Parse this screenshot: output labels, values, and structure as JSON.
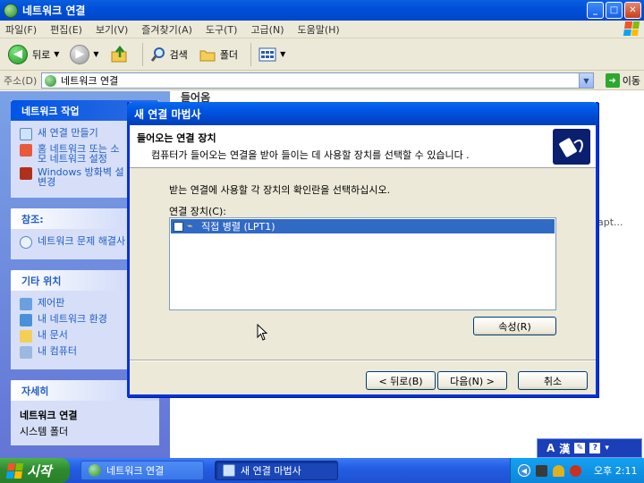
{
  "explorer": {
    "title": "네트워크 연결",
    "menu": [
      "파일(F)",
      "편집(E)",
      "보기(V)",
      "즐겨찾기(A)",
      "도구(T)",
      "고급(N)",
      "도움말(H)"
    ],
    "toolbar": {
      "back": "뒤로",
      "search": "검색",
      "folders": "폴더"
    },
    "address": {
      "label": "주소(D)",
      "value": "네트워크 연결",
      "go": "이동"
    },
    "main_heading": "들어옴",
    "main_trunc": "apt..."
  },
  "sidebar": {
    "network_tasks": {
      "title": "네트워크 작업",
      "items": [
        "새 연결 만들기",
        "홈 네트워크 또는 소",
        "모 네트워크 설정",
        "Windows 방화벽 설",
        "변경"
      ]
    },
    "see_also": {
      "title": "참조:",
      "items": [
        "네트워크 문제 해결사"
      ]
    },
    "other_places": {
      "title": "기타 위치",
      "items": [
        "제어판",
        "내 네트워크 환경",
        "내 문서",
        "내 컴퓨터"
      ]
    },
    "details": {
      "title": "자세히",
      "name": "네트워크 연결",
      "type": "시스템 폴더"
    }
  },
  "dialog": {
    "title": "새 연결 마법사",
    "header_title": "들어오는 연결 장치",
    "header_desc": "컴퓨터가 들어오는 연결을 받아 들이는 데 사용할 장치를 선택할 수 있습니다 .",
    "instruction": "받는 연결에 사용할 각 장치의 확인란을 선택하십시오.",
    "devices_label": "연결 장치(C):",
    "devices": [
      {
        "label": "직접 병렬 (LPT1)",
        "checked": false,
        "selected": true
      }
    ],
    "properties": "속성(R)",
    "back": "< 뒤로(B)",
    "next": "다음(N) >",
    "cancel": "취소"
  },
  "taskbar": {
    "start": "시작",
    "tasks": [
      "네트워크 연결",
      "새 연결 마법사"
    ],
    "clock": "오후 2:11"
  },
  "langbar": {
    "a": "A",
    "han": "漢"
  },
  "colors": {
    "xp_blue": "#0054e3",
    "start_green": "#2f8b2f",
    "selection": "#316ac5",
    "sidebar_link": "#215dc6"
  }
}
